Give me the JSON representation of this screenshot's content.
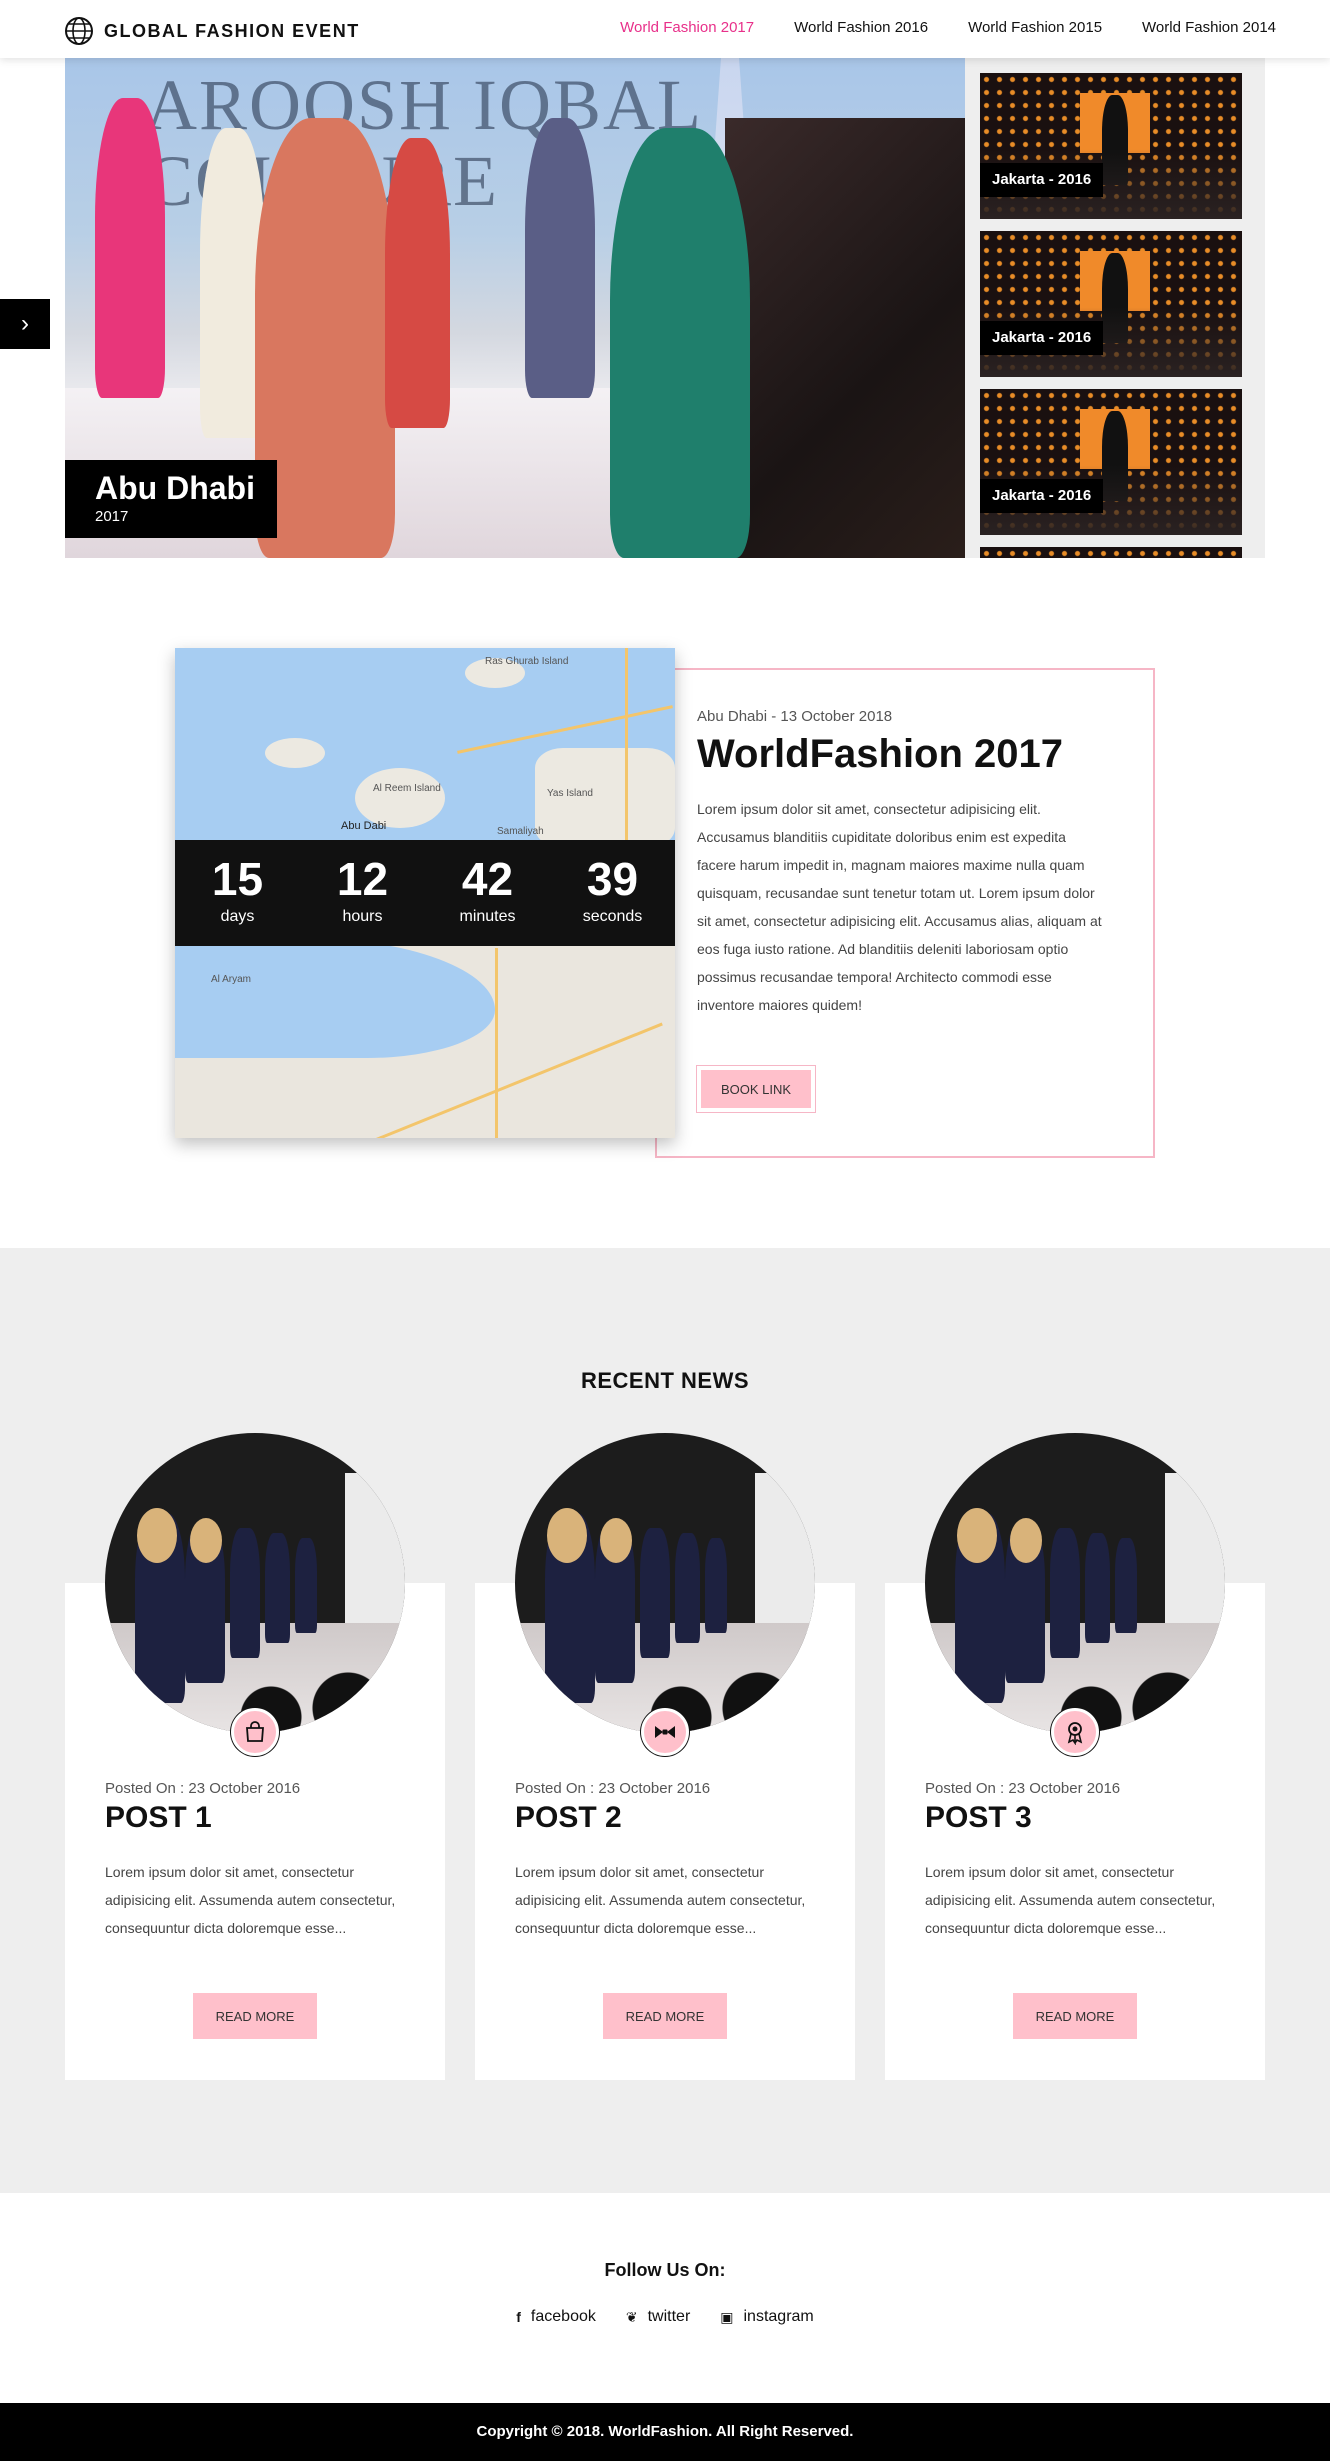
{
  "header": {
    "logo_text": "GLOBAL FASHION EVENT",
    "logo_icon": "globe-icon",
    "nav": [
      {
        "label": "World Fashion 2017",
        "active": true
      },
      {
        "label": "World Fashion 2016",
        "active": false
      },
      {
        "label": "World Fashion 2015",
        "active": false
      },
      {
        "label": "World Fashion 2014",
        "active": false
      }
    ]
  },
  "hero": {
    "bg_text_line1": "AROOSH IQBAL",
    "bg_text_line2": "COUTURE",
    "city": "Abu Dhabi",
    "year": "2017",
    "arrow_icon": "chevron-right-icon"
  },
  "thumbnails": [
    {
      "label": "Jakarta - 2016"
    },
    {
      "label": "Jakarta - 2016"
    },
    {
      "label": "Jakarta - 2016"
    }
  ],
  "event": {
    "map_labels": [
      "Ras Ghurab Island",
      "Al Reem Island",
      "Abu Dabi",
      "Yas Island",
      "Samaliyah",
      "Al Aryam"
    ],
    "countdown": [
      {
        "value": "15",
        "label": "days"
      },
      {
        "value": "12",
        "label": "hours"
      },
      {
        "value": "42",
        "label": "minutes"
      },
      {
        "value": "39",
        "label": "seconds"
      }
    ],
    "date": "Abu Dhabi - 13 October 2018",
    "title": "WorldFashion 2017",
    "description": "Lorem ipsum dolor sit amet, consectetur adipisicing elit. Accusamus blanditiis cupiditate doloribus enim est expedita facere harum impedit in, magnam maiores maxime nulla quam quisquam, recusandae sunt tenetur totam ut. Lorem ipsum dolor sit amet, consectetur adipisicing elit. Accusamus alias, aliquam at eos fuga iusto ratione. Ad blanditiis deleniti laboriosam optio possimus recusandae tempora! Architecto commodi esse inventore maiores quidem!",
    "book_label": "BOOK LINK"
  },
  "news": {
    "title": "RECENT NEWS",
    "posts": [
      {
        "date": "Posted On : 23 October 2016",
        "title": "POST 1",
        "icon": "shopping-bag-icon",
        "desc": "Lorem ipsum dolor sit amet, consectetur adipisicing elit. Assumenda autem consectetur, consequuntur dicta doloremque esse...",
        "button": "READ MORE"
      },
      {
        "date": "Posted On : 23 October 2016",
        "title": "POST 2",
        "icon": "bow-tie-icon",
        "desc": "Lorem ipsum dolor sit amet, consectetur adipisicing elit. Assumenda autem consectetur, consequuntur dicta doloremque esse...",
        "button": "READ MORE"
      },
      {
        "date": "Posted On : 23 October 2016",
        "title": "POST 3",
        "icon": "award-ribbon-icon",
        "desc": "Lorem ipsum dolor sit amet, consectetur adipisicing elit. Assumenda autem consectetur, consequuntur dicta doloremque esse...",
        "button": "READ MORE"
      }
    ]
  },
  "follow": {
    "title": "Follow Us On:",
    "links": [
      {
        "label": "facebook",
        "icon": "facebook-icon",
        "glyph": "f"
      },
      {
        "label": "twitter",
        "icon": "twitter-icon",
        "glyph": "❦"
      },
      {
        "label": "instagram",
        "icon": "instagram-icon",
        "glyph": "▣"
      }
    ]
  },
  "footer": {
    "copyright": "Copyright © 2018. WorldFashion. All Right Reserved."
  },
  "colors": {
    "accent": "#e8308a",
    "pink": "#ffc0cb",
    "dark": "#000000",
    "gray_bg": "#eeeeee"
  }
}
